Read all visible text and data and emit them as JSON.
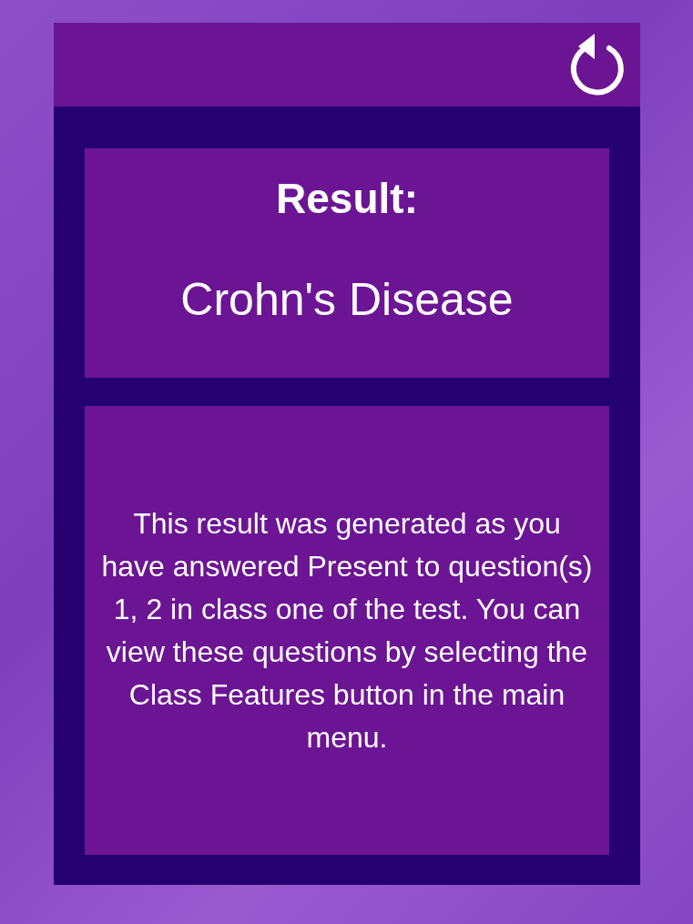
{
  "result": {
    "heading": "Result:",
    "diagnosis": "Crohn's Disease"
  },
  "explanation": "This result was generated as you have answered Present to question(s) 1, 2 in class one of the test. You can view these questions by selecting the Class Features button in the main menu."
}
